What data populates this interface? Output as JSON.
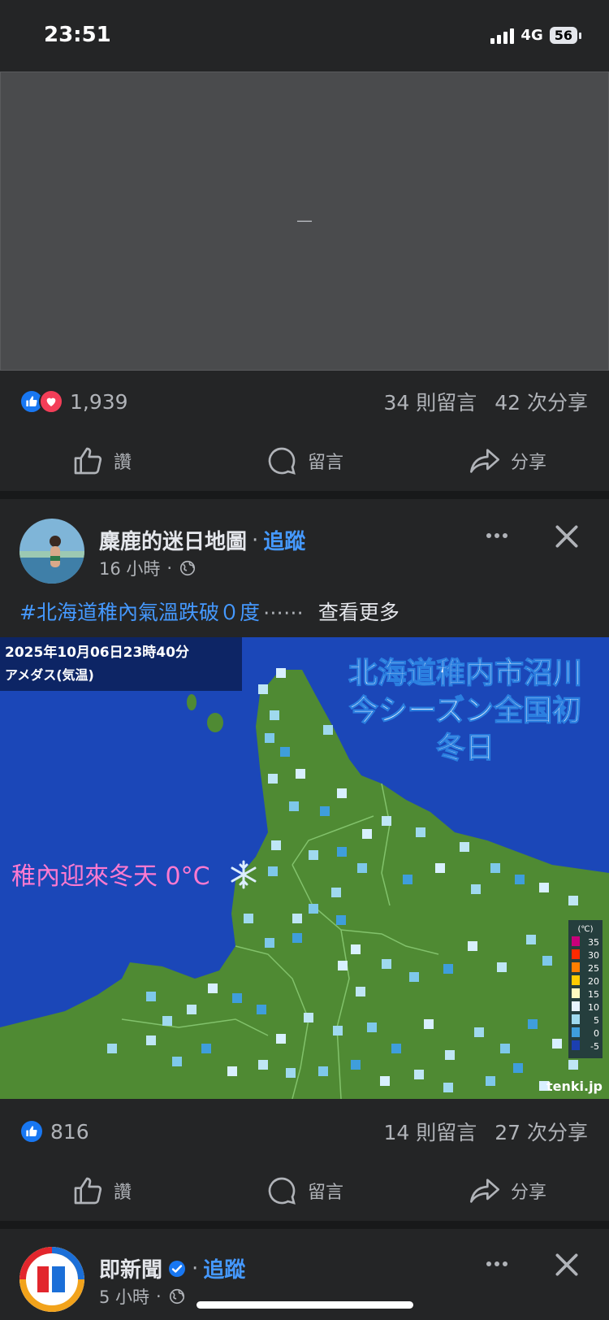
{
  "status": {
    "time": "23:51",
    "network": "4G",
    "battery": "56"
  },
  "post1": {
    "likes": "1,939",
    "comments": "34 則留言",
    "shares": "42 次分享",
    "actions": {
      "like": "讚",
      "comment": "留言",
      "share": "分享"
    }
  },
  "post2": {
    "author": "麋鹿的迷日地圖",
    "follow": "追蹤",
    "time": "16 小時",
    "hashtag": "#北海道稚內氣溫跌破０度",
    "ellipsis": "⋯⋯",
    "see_more": "查看更多",
    "map": {
      "timestamp": "2025年10月06日23時40分",
      "subtitle": "アメダス(気温)",
      "headline": [
        "北海道稚内市沼川",
        "今シーズン全国初",
        "冬日"
      ],
      "annotation": "稚內迎來冬天 0°C",
      "legend_unit": "(℃)",
      "legend_values": [
        "35",
        "30",
        "25",
        "20",
        "15",
        "10",
        "5",
        "0",
        "-5"
      ],
      "credit": "tenki.jp"
    },
    "likes": "816",
    "comments": "14 則留言",
    "shares": "27 次分享",
    "actions": {
      "like": "讚",
      "comment": "留言",
      "share": "分享"
    }
  },
  "post3": {
    "author": "即新聞",
    "follow": "追蹤",
    "time": "5 小時"
  },
  "colors": {
    "accent": "#4599ff",
    "like_blue": "#1877f2",
    "love_red": "#f33e58",
    "land_green": "#4f8a33",
    "sea_blue": "#1b47b8"
  }
}
